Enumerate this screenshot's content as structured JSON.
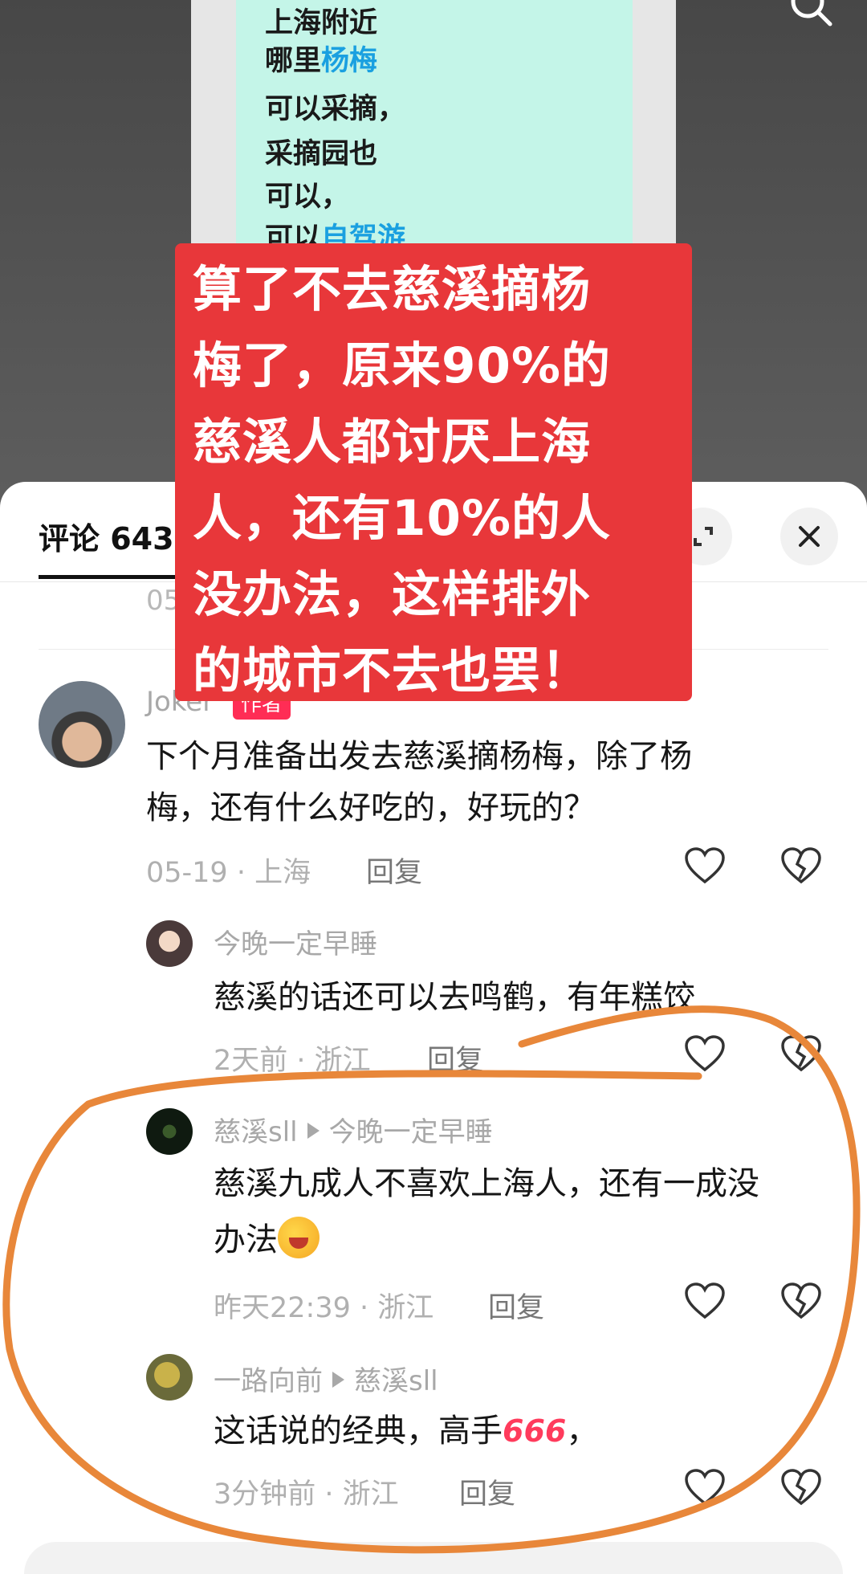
{
  "video": {
    "note_lines": [
      {
        "text": "上海附近",
        "highlight": ""
      },
      {
        "text": "哪里",
        "highlight": "杨梅"
      },
      {
        "text": "可以采摘，",
        "highlight": ""
      },
      {
        "text": "采摘园也",
        "highlight": ""
      },
      {
        "text": "可以，",
        "highlight": ""
      },
      {
        "text": "可以",
        "highlight": "自驾游"
      }
    ],
    "banner_lines": [
      "算了不去慈溪摘杨",
      "梅了，原来90%的",
      "慈溪人都讨厌上海",
      "人，还有10%的人",
      "没办法，这样排外",
      "的城市不去也罢！"
    ]
  },
  "sheet": {
    "comment_count": "评论 643",
    "prev_date": "05",
    "comments": [
      {
        "user": "Joker",
        "badge": "作者",
        "text_lines": [
          "下个月准备出发去慈溪摘杨梅，除了杨",
          "梅，还有什么好吃的，好玩的？"
        ],
        "meta": "05-19 · 上海",
        "reply": "回复"
      },
      {
        "user": "今晚一定早睡",
        "text_lines": [
          "慈溪的话还可以去鸣鹤，有年糕饺"
        ],
        "meta": "2天前 · 浙江",
        "reply": "回复"
      },
      {
        "user": "慈溪sll",
        "reply_to": "今晚一定早睡",
        "text_lines": [
          "慈溪九成人不喜欢上海人，还有一成没",
          "办法"
        ],
        "meta": "昨天22:39 · 浙江",
        "reply": "回复"
      },
      {
        "user": "一路向前",
        "reply_to": "慈溪sll",
        "text_lines": [
          "这话说的经典，高手",
          "666",
          "，"
        ],
        "meta": "3分钟前 · 浙江",
        "reply": "回复"
      }
    ]
  },
  "icons": [
    "search-icon",
    "expand-icon",
    "close-icon",
    "like-heart-icon",
    "dislike-broken-heart-icon",
    "laughing-emoji-icon"
  ],
  "colors": {
    "banner": "#e8373a",
    "note_card": "#c4f5e8",
    "highlight": "#1aa0e0",
    "annotation": "#e8873a",
    "author_badge": "#ff2d55"
  }
}
